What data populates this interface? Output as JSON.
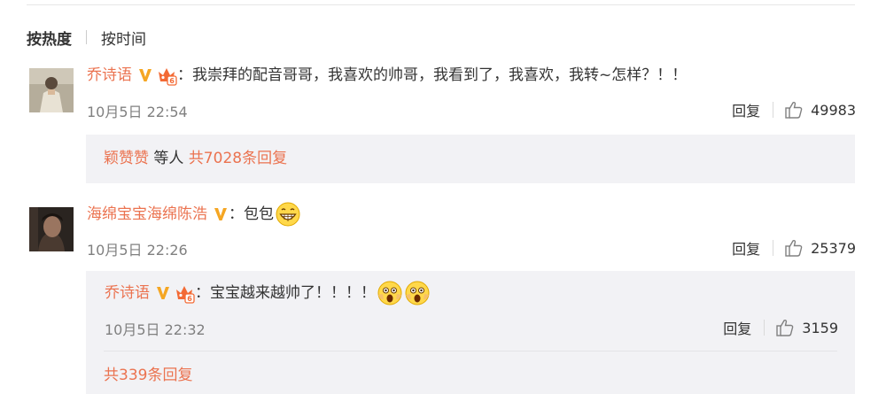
{
  "sort": {
    "hot": "按热度",
    "time": "按时间"
  },
  "comments": [
    {
      "username": "乔诗语",
      "verified": "V",
      "text": "：我崇拜的配音哥哥，我喜欢的帅哥，我看到了，我喜欢，我转~怎样？！！",
      "time": "10月5日 22:54",
      "reply_label": "回复",
      "likes": "49983",
      "summary": {
        "liker": "颖赞赞",
        "etc": " 等人 ",
        "reply_count": "共7028条回复"
      }
    },
    {
      "username": "海绵宝宝海绵陈浩",
      "verified": "V",
      "text": "：包包",
      "time": "10月5日 22:26",
      "reply_label": "回复",
      "likes": "25379",
      "nested_reply": {
        "username": "乔诗语",
        "verified": "V",
        "text": "：宝宝越来越帅了！！！！",
        "time": "10月5日 22:32",
        "reply_label": "回复",
        "likes": "3159"
      },
      "summary": {
        "reply_count": "共339条回复"
      }
    }
  ],
  "icons": {
    "verified": "verified-v-icon",
    "crown": "crown-member-icon",
    "like": "thumbs-up-icon",
    "grin": "grin-emoji-icon",
    "scream": "scream-emoji-icon"
  },
  "colors": {
    "accent": "#eb7350",
    "verified": "#f5a623",
    "reply_bg": "#f2f2f5"
  }
}
